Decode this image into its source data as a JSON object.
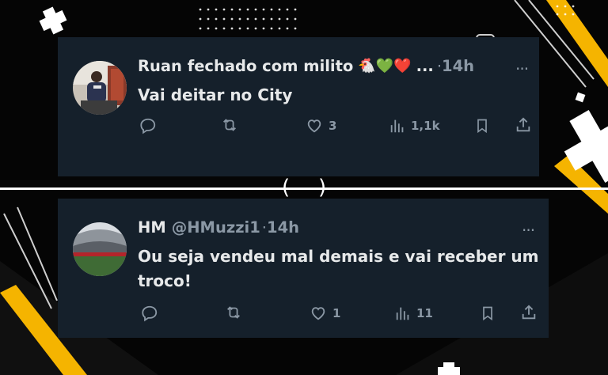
{
  "tweets": [
    {
      "display_name": "Ruan fechado com milito",
      "emojis": "🐔💚❤️",
      "ellipsis": "...",
      "dot": "·",
      "time": "14h",
      "more": "···",
      "text": "Vai deitar no City",
      "likes": "3",
      "views": "1,1k"
    },
    {
      "display_name": "HM",
      "handle": "@HMuzzi1",
      "dot": "·",
      "time": "14h",
      "more": "···",
      "text_line1": "Ou seja vendeu mal demais e vai receber um",
      "text_line2": "troco!",
      "likes": "1",
      "views": "11"
    }
  ],
  "separator": {
    "left": "(",
    "right": ")"
  },
  "colors": {
    "card": "#15202b",
    "text": "#e7e9ea",
    "muted": "#8b98a5",
    "accent": "#ffb800"
  }
}
